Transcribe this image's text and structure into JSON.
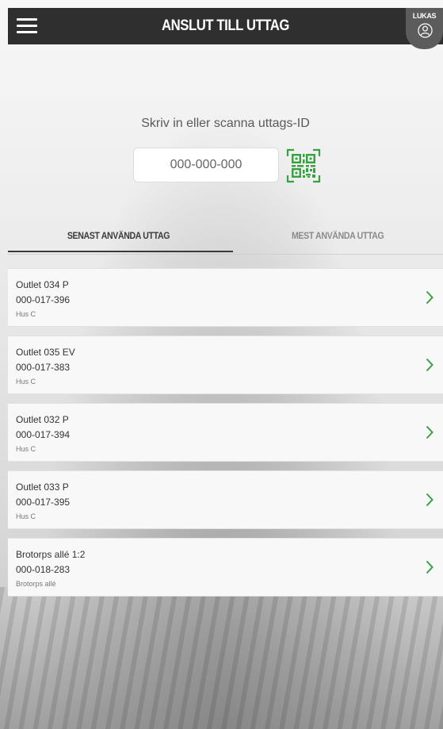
{
  "header": {
    "title": "ANSLUT TILL UTTAG",
    "menu_icon": "hamburger-menu-icon",
    "user": {
      "name": "LUKAS",
      "icon": "user-avatar-icon"
    },
    "colors": {
      "background": "#2f2f2f",
      "user_tab": "#5c5c5c"
    }
  },
  "entry": {
    "prompt": "Skriv in eller scanna uttags-ID",
    "input_placeholder": "000-000-000",
    "qr_icon": "qr-code-icon",
    "qr_color": "#3aa142"
  },
  "tabs": [
    {
      "label": "SENAST ANVÄNDA UTTAG",
      "active": true
    },
    {
      "label": "MEST ANVÄNDA UTTAG",
      "active": false
    }
  ],
  "outlets": [
    {
      "name": "Outlet 034 P",
      "id": "000-017-396",
      "location": "Hus C"
    },
    {
      "name": "Outlet 035 EV",
      "id": "000-017-383",
      "location": "Hus C"
    },
    {
      "name": "Outlet 032 P",
      "id": "000-017-394",
      "location": "Hus C"
    },
    {
      "name": "Outlet 033 P",
      "id": "000-017-395",
      "location": "Hus C"
    },
    {
      "name": "Brotorps allé 1:2",
      "id": "000-018-283",
      "location": "Brotorps allé"
    }
  ],
  "accent_color": "#3aa142",
  "chevron_icon": "chevron-right-icon"
}
